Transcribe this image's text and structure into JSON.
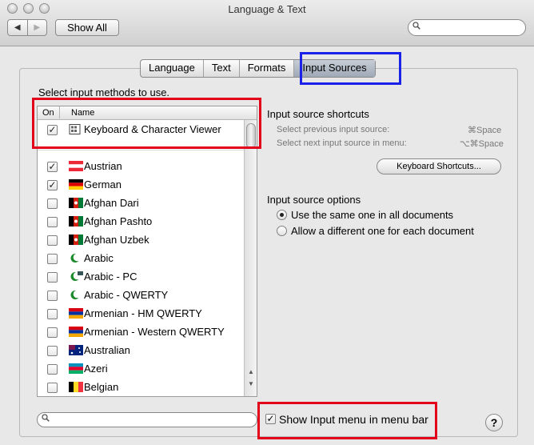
{
  "window": {
    "title": "Language & Text"
  },
  "toolbar": {
    "show_all_label": "Show All",
    "back_glyph": "◀",
    "forward_glyph": "▶",
    "search_value": ""
  },
  "tabs": [
    {
      "label": "Language",
      "active": false
    },
    {
      "label": "Text",
      "active": false
    },
    {
      "label": "Formats",
      "active": false
    },
    {
      "label": "Input Sources",
      "active": true
    }
  ],
  "input_methods": {
    "instruction": "Select input methods to use.",
    "col_on": "On",
    "col_name": "Name",
    "items": [
      {
        "label": "Keyboard & Character Viewer",
        "checked": true,
        "icon": "keyboard-viewer-icon"
      },
      {
        "label": "Austrian",
        "checked": true,
        "icon": "austria-flag-icon"
      },
      {
        "label": "German",
        "checked": true,
        "icon": "germany-flag-icon"
      },
      {
        "label": "Afghan Dari",
        "checked": false,
        "icon": "afghanistan-flag-icon"
      },
      {
        "label": "Afghan Pashto",
        "checked": false,
        "icon": "afghanistan-flag-icon"
      },
      {
        "label": "Afghan Uzbek",
        "checked": false,
        "icon": "afghanistan-flag-icon"
      },
      {
        "label": "Arabic",
        "checked": false,
        "icon": "crescent-icon"
      },
      {
        "label": "Arabic - PC",
        "checked": false,
        "icon": "crescent-icon"
      },
      {
        "label": "Arabic - QWERTY",
        "checked": false,
        "icon": "crescent-icon"
      },
      {
        "label": "Armenian - HM QWERTY",
        "checked": false,
        "icon": "armenia-flag-icon"
      },
      {
        "label": "Armenian - Western QWERTY",
        "checked": false,
        "icon": "armenia-flag-icon"
      },
      {
        "label": "Australian",
        "checked": false,
        "icon": "australia-flag-icon"
      },
      {
        "label": "Azeri",
        "checked": false,
        "icon": "azerbaijan-flag-icon"
      },
      {
        "label": "Belgian",
        "checked": false,
        "icon": "belgium-flag-icon"
      }
    ],
    "filter_value": ""
  },
  "shortcuts": {
    "heading": "Input source shortcuts",
    "prev_label": "Select previous input source:",
    "prev_key": "⌘Space",
    "next_label": "Select next input source in menu:",
    "next_key": "⌥⌘Space",
    "button_label": "Keyboard Shortcuts..."
  },
  "options": {
    "heading": "Input source options",
    "radio_same": "Use the same one in all documents",
    "radio_diff": "Allow a different one for each document",
    "selected": "same"
  },
  "footer": {
    "show_menu_label": "Show Input menu in menu bar",
    "show_menu_checked": true,
    "help_glyph": "?"
  },
  "colors": {
    "highlight_red": "#e3001b",
    "highlight_blue": "#1b22e8",
    "tab_active": "#a9b3bf"
  }
}
